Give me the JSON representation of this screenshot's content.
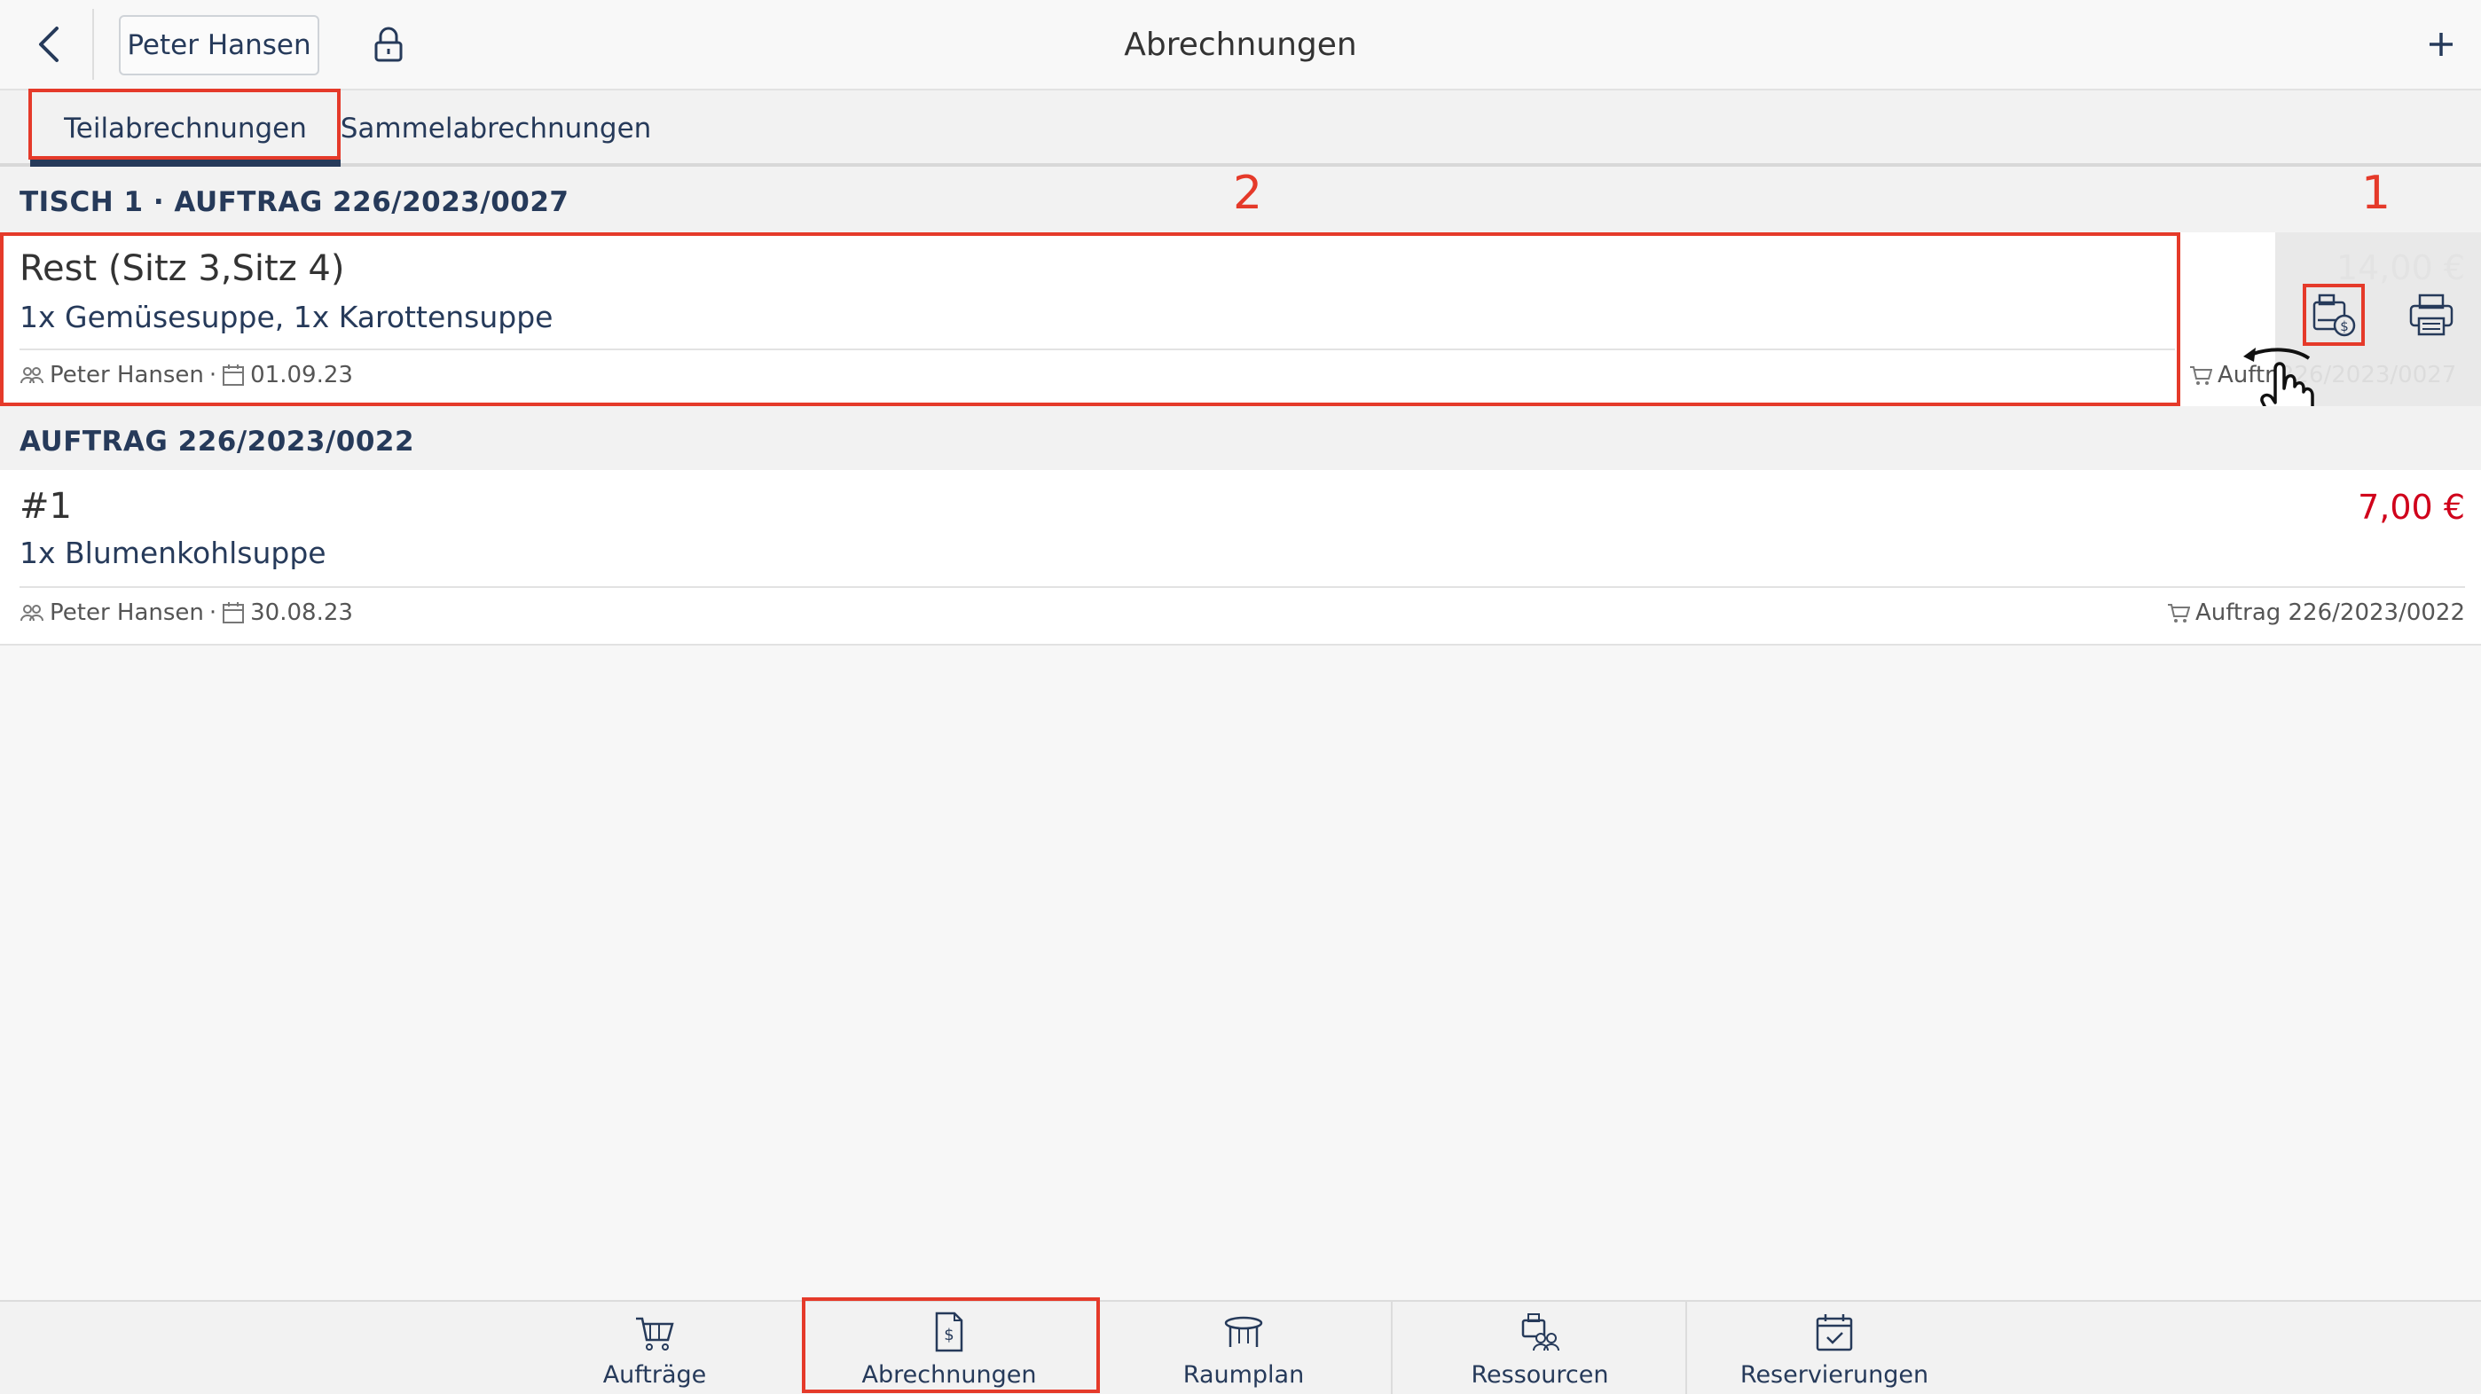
{
  "header": {
    "title": "Abrechnungen",
    "user_button": "Peter Hansen",
    "icons": {
      "back": "chevron-left-icon",
      "lock": "lock-icon",
      "add": "plus-icon"
    }
  },
  "tabs": [
    {
      "label": "Teilabrechnungen",
      "active": true
    },
    {
      "label": "Sammelabrechnungen",
      "active": false
    }
  ],
  "sections": [
    {
      "heading": "TISCH 1 · AUFTRAG 226/2023/0027",
      "rows": [
        {
          "title": "Rest (Sitz 3,Sitz 4)",
          "items": "1x Gemüsesuppe, 1x Karottensuppe",
          "user": "Peter Hansen",
          "date": "01.09.23",
          "price": "14,00 €",
          "order": "Auftrag 226/2023/0027",
          "order_visible": "Auftr",
          "order_faded": "226/2023/0027",
          "swiped": true
        }
      ]
    },
    {
      "heading": "AUFTRAG 226/2023/0022",
      "rows": [
        {
          "title": "#1",
          "items": "1x Blumenkohlsuppe",
          "user": "Peter Hansen",
          "date": "30.08.23",
          "price": "7,00 €",
          "order": "Auftrag 226/2023/0022",
          "swiped": false
        }
      ]
    }
  ],
  "annotations": {
    "marker_1": "1",
    "marker_2": "2"
  },
  "bottom_nav": [
    {
      "label": "Aufträge",
      "icon": "shopping-cart-icon",
      "active": false
    },
    {
      "label": "Abrechnungen",
      "icon": "invoice-icon",
      "active": true
    },
    {
      "label": "Raumplan",
      "icon": "table-icon",
      "active": false
    },
    {
      "label": "Ressourcen",
      "icon": "resources-icon",
      "active": false
    },
    {
      "label": "Reservierungen",
      "icon": "calendar-check-icon",
      "active": false
    }
  ],
  "colors": {
    "accent": "#263a5a",
    "price_red": "#d0021b",
    "annotation_red": "#e53a2a",
    "background": "#f7f7f7"
  }
}
